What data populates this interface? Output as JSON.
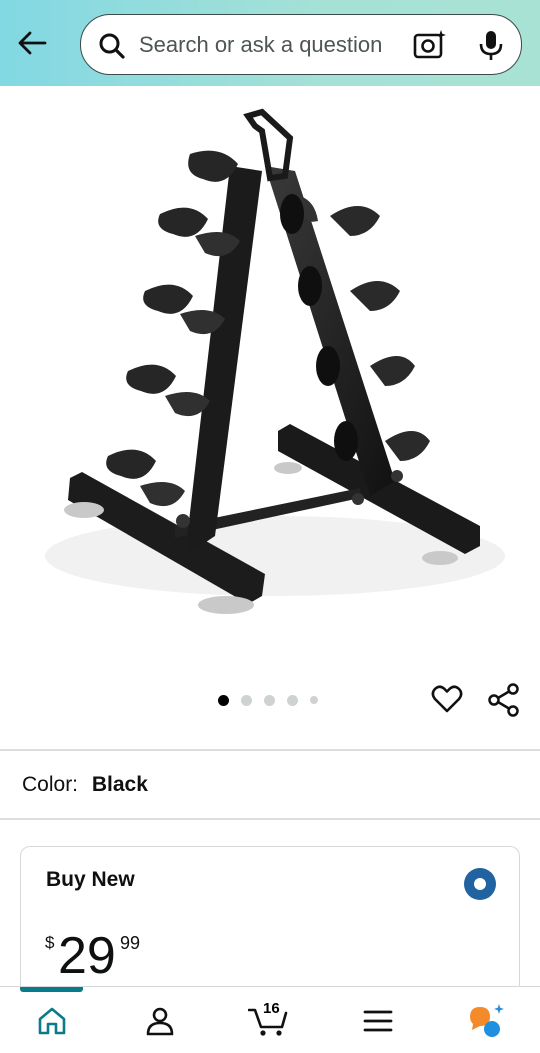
{
  "search": {
    "placeholder": "Search or ask a question"
  },
  "carousel": {
    "total_images": 5,
    "current_index": 1
  },
  "product": {
    "color_label": "Color:",
    "color_value": "Black"
  },
  "buy_box": {
    "title": "Buy New",
    "selected": true,
    "price_currency": "$",
    "price_whole": "29",
    "price_fraction": "99"
  },
  "bottom_nav": {
    "active_tab": "home",
    "cart_count": "16",
    "items": [
      {
        "name": "home",
        "icon": "home-icon"
      },
      {
        "name": "account",
        "icon": "user-icon"
      },
      {
        "name": "cart",
        "icon": "cart-icon"
      },
      {
        "name": "menu",
        "icon": "menu-icon"
      },
      {
        "name": "rufus",
        "icon": "ai-assistant-icon"
      }
    ]
  },
  "colors": {
    "header_gradient_start": "#82d8e3",
    "header_gradient_end": "#a8e2d4",
    "radio_selected": "#2162a1",
    "nav_active": "#0a7b8a",
    "assistant_orange": "#f58a2b",
    "assistant_blue": "#1f8fe0"
  }
}
